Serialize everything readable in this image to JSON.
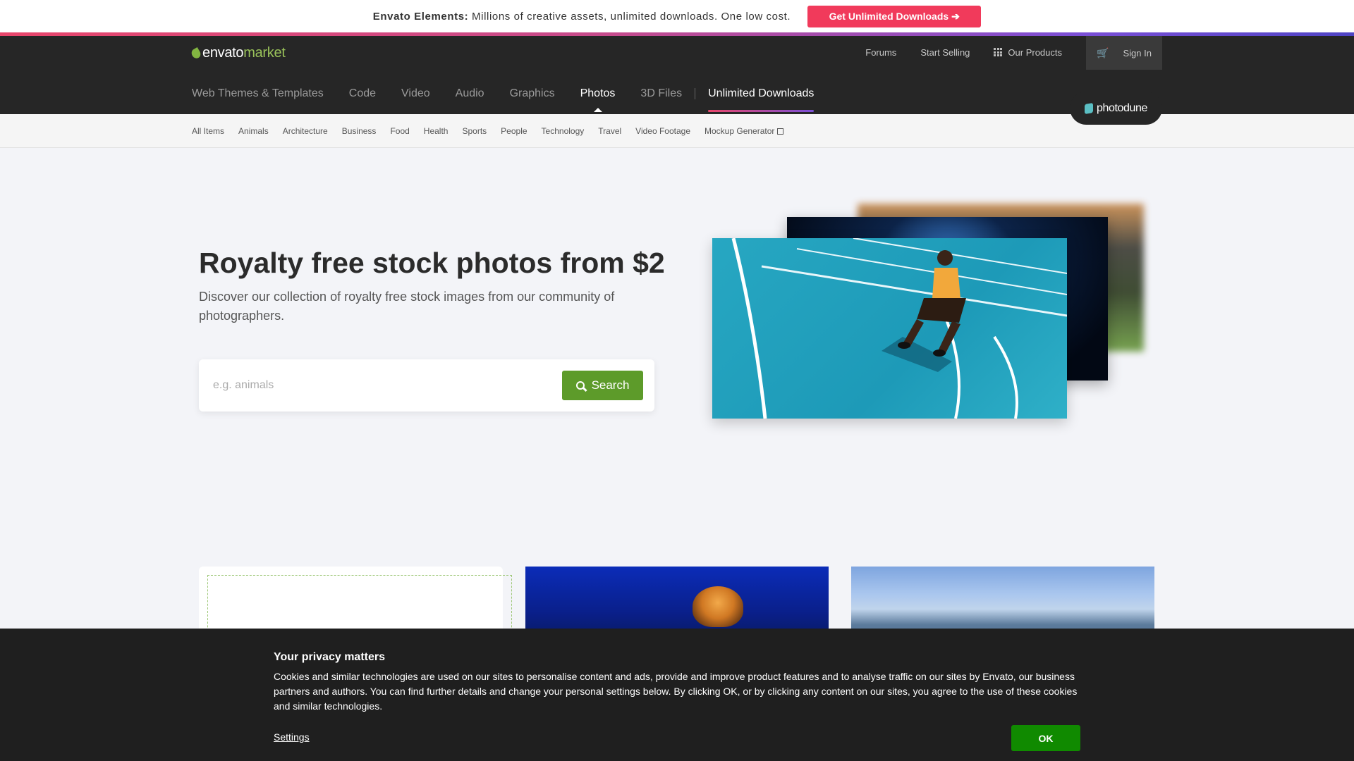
{
  "promo": {
    "brand": "Envato Elements:",
    "text": "Millions of creative assets, unlimited downloads. One low cost.",
    "button_label": "Get Unlimited Downloads ➔"
  },
  "header": {
    "logo_part1": "envato",
    "logo_part2": "market",
    "top_links": {
      "forums": "Forums",
      "start_selling": "Start Selling",
      "our_products": "Our Products",
      "sign_in": "Sign In"
    },
    "categories": [
      "Web Themes & Templates",
      "Code",
      "Video",
      "Audio",
      "Graphics",
      "Photos",
      "3D Files"
    ],
    "active_category": "Photos",
    "unlimited": "Unlimited Downloads",
    "site_badge": "photodune"
  },
  "subnav": {
    "items": [
      "All Items",
      "Animals",
      "Architecture",
      "Business",
      "Food",
      "Health",
      "Sports",
      "People",
      "Technology",
      "Travel",
      "Video Footage"
    ],
    "mockup": "Mockup Generator"
  },
  "hero": {
    "title": "Royalty free stock photos from $2",
    "subtitle": "Discover our collection of royalty free stock images from our community of photographers.",
    "search_placeholder": "e.g. animals",
    "search_button": "Search"
  },
  "cookie": {
    "title": "Your privacy matters",
    "text": "Cookies and similar technologies are used on our sites to personalise content and ads, provide and improve product features and to analyse traffic on our sites by Envato, our business partners and authors. You can find further details and change your personal settings below. By clicking OK, or by clicking any content on our sites, you agree to the use of these cookies and similar technologies.",
    "settings": "Settings",
    "ok": "OK"
  },
  "colors": {
    "promo_button": "#f13a5b",
    "header_bg": "#262626",
    "search_button": "#5d9b2a",
    "ok_button": "#108a00"
  }
}
